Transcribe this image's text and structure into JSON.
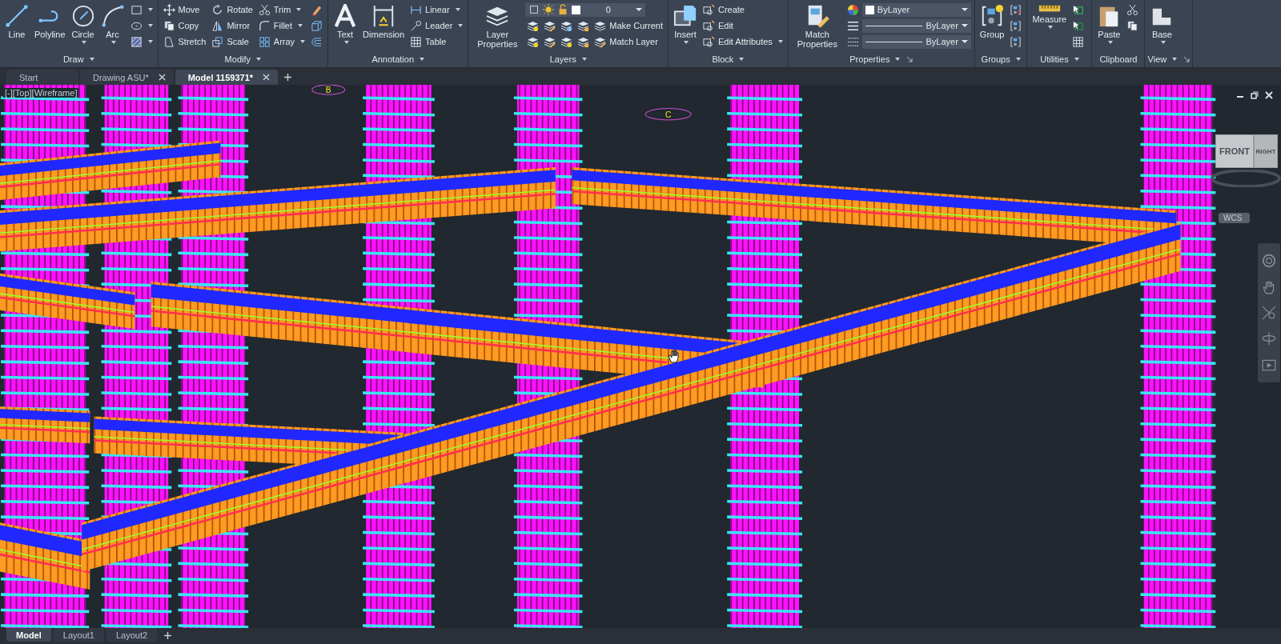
{
  "ribbon": {
    "panels": [
      {
        "title": "Draw",
        "dropdown": true,
        "launcher": false,
        "columns": [
          {
            "kind": "large",
            "label": "Line",
            "dropdown": false
          },
          {
            "kind": "large",
            "label": "Polyline",
            "dropdown": false
          },
          {
            "kind": "large",
            "label": "Circle",
            "dropdown": true
          },
          {
            "kind": "large",
            "label": "Arc",
            "dropdown": true
          },
          {
            "kind": "stack",
            "rows": [
              [
                {
                  "kind": "button",
                  "dropdown": true
                }
              ],
              [
                {
                  "kind": "button",
                  "dropdown": true
                }
              ],
              [
                {
                  "kind": "button",
                  "dropdown": true
                }
              ]
            ]
          }
        ]
      },
      {
        "title": "Modify",
        "dropdown": true,
        "launcher": false,
        "columns": [
          {
            "kind": "stack",
            "rows": [
              [
                {
                  "kind": "button",
                  "label": "Move",
                  "dropdown": false
                }
              ],
              [
                {
                  "kind": "button",
                  "label": "Copy",
                  "dropdown": false
                }
              ],
              [
                {
                  "kind": "button",
                  "label": "Stretch",
                  "dropdown": false
                }
              ]
            ]
          },
          {
            "kind": "stack",
            "rows": [
              [
                {
                  "kind": "button",
                  "label": "Rotate",
                  "dropdown": false
                }
              ],
              [
                {
                  "kind": "button",
                  "label": "Mirror",
                  "dropdown": false
                }
              ],
              [
                {
                  "kind": "button",
                  "label": "Scale",
                  "dropdown": false
                }
              ]
            ]
          },
          {
            "kind": "stack",
            "rows": [
              [
                {
                  "kind": "button",
                  "label": "Trim",
                  "dropdown": true
                }
              ],
              [
                {
                  "kind": "button",
                  "label": "Fillet",
                  "dropdown": true
                }
              ],
              [
                {
                  "kind": "button",
                  "label": "Array",
                  "dropdown": true
                }
              ]
            ]
          },
          {
            "kind": "stack",
            "rows": [
              [
                {
                  "kind": "button",
                  "dropdown": false
                }
              ],
              [
                {
                  "kind": "button",
                  "dropdown": false
                }
              ],
              [
                {
                  "kind": "button",
                  "dropdown": false
                }
              ]
            ]
          }
        ]
      },
      {
        "title": "Annotation",
        "dropdown": true,
        "launcher": false,
        "columns": [
          {
            "kind": "large",
            "label": "Text",
            "dropdown": true
          },
          {
            "kind": "large",
            "label": "Dimension",
            "dropdown": false
          },
          {
            "kind": "stack",
            "rows": [
              [
                {
                  "kind": "button",
                  "label": "Linear",
                  "dropdown": true
                }
              ],
              [
                {
                  "kind": "button",
                  "label": "Leader",
                  "dropdown": true
                }
              ],
              [
                {
                  "kind": "button",
                  "label": "Table",
                  "dropdown": false
                }
              ]
            ]
          }
        ]
      },
      {
        "title": "Layers",
        "dropdown": true,
        "launcher": false,
        "columns": [
          {
            "kind": "large",
            "label": "Layer Properties",
            "dropdown": false
          },
          {
            "kind": "stack",
            "rows": [
              [
                {
                  "kind": "layer-combo",
                  "value": "0"
                }
              ],
              [
                {
                  "kind": "button",
                  "dropdown": false
                },
                {
                  "kind": "button",
                  "dropdown": false
                },
                {
                  "kind": "button",
                  "dropdown": false
                },
                {
                  "kind": "button",
                  "dropdown": false
                },
                {
                  "kind": "button",
                  "label": "Make Current",
                  "dropdown": false
                }
              ],
              [
                {
                  "kind": "button",
                  "dropdown": false
                },
                {
                  "kind": "button",
                  "dropdown": false
                },
                {
                  "kind": "button",
                  "dropdown": false
                },
                {
                  "kind": "button",
                  "dropdown": false
                },
                {
                  "kind": "button",
                  "label": "Match Layer",
                  "dropdown": false
                }
              ]
            ]
          }
        ]
      },
      {
        "title": "Block",
        "dropdown": true,
        "launcher": false,
        "columns": [
          {
            "kind": "large",
            "label": "Insert",
            "dropdown": true
          },
          {
            "kind": "stack",
            "rows": [
              [
                {
                  "kind": "button",
                  "label": "Create",
                  "dropdown": false
                }
              ],
              [
                {
                  "kind": "button",
                  "label": "Edit",
                  "dropdown": false
                }
              ],
              [
                {
                  "kind": "button",
                  "label": "Edit Attributes",
                  "dropdown": true
                }
              ]
            ]
          }
        ]
      },
      {
        "title": "Properties",
        "dropdown": true,
        "launcher": true,
        "columns": [
          {
            "kind": "large",
            "label": "Match Properties",
            "dropdown": false
          },
          {
            "kind": "stack",
            "rows": [
              [
                {
                  "kind": "button",
                  "dropdown": false
                },
                {
                  "kind": "color-combo",
                  "value": "ByLayer"
                }
              ],
              [
                {
                  "kind": "button",
                  "dropdown": false
                },
                {
                  "kind": "line-combo",
                  "value": "ByLayer"
                }
              ],
              [
                {
                  "kind": "button",
                  "dropdown": false
                },
                {
                  "kind": "line-combo",
                  "value": "ByLayer"
                }
              ]
            ]
          }
        ]
      },
      {
        "title": "Groups",
        "dropdown": true,
        "launcher": false,
        "columns": [
          {
            "kind": "large",
            "label": "Group",
            "dropdown": false
          },
          {
            "kind": "stack",
            "rows": [
              [
                {
                  "kind": "button",
                  "dropdown": false
                }
              ],
              [
                {
                  "kind": "button",
                  "dropdown": false
                }
              ],
              [
                {
                  "kind": "button",
                  "dropdown": false
                }
              ]
            ]
          }
        ]
      },
      {
        "title": "Utilities",
        "dropdown": true,
        "launcher": false,
        "columns": [
          {
            "kind": "large",
            "label": "Measure",
            "dropdown": true
          },
          {
            "kind": "stack",
            "rows": [
              [
                {
                  "kind": "button",
                  "dropdown": false
                }
              ],
              [
                {
                  "kind": "button",
                  "dropdown": false
                }
              ],
              [
                {
                  "kind": "button",
                  "dropdown": false
                }
              ]
            ]
          }
        ]
      },
      {
        "title": "Clipboard",
        "dropdown": false,
        "launcher": false,
        "columns": [
          {
            "kind": "large",
            "label": "Paste",
            "dropdown": true
          },
          {
            "kind": "stack",
            "rows": [
              [
                {
                  "kind": "button",
                  "dropdown": false
                }
              ],
              [
                {
                  "kind": "button",
                  "dropdown": false
                }
              ]
            ]
          }
        ]
      },
      {
        "title": "View",
        "dropdown": true,
        "launcher": true,
        "columns": [
          {
            "kind": "large",
            "label": "Base",
            "dropdown": true
          }
        ]
      }
    ]
  },
  "document_tabs": [
    {
      "label": "Start",
      "selected": false,
      "closable": false
    },
    {
      "label": "Drawing ASU*",
      "selected": false,
      "closable": true
    },
    {
      "label": "Model 1159371*",
      "selected": true,
      "closable": true
    }
  ],
  "viewport": {
    "label": "[-][Top][Wireframe]",
    "grid_labels": [
      "B",
      "C"
    ],
    "viewcube": {
      "faces": [
        "FRONT",
        "RIGHT"
      ]
    },
    "ucs_button": "WCS"
  },
  "layout_tabs": [
    {
      "label": "Model",
      "selected": true
    },
    {
      "label": "Layout1",
      "selected": false
    },
    {
      "label": "Layout2",
      "selected": false
    }
  ]
}
